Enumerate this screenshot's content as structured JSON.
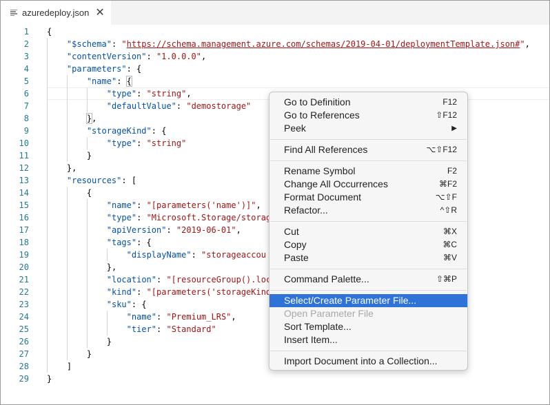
{
  "tab": {
    "title": "azuredeploy.json",
    "close_glyph": "✕",
    "file_icon": "file-lines-icon"
  },
  "editor": {
    "lines": [
      {
        "n": "1",
        "tokens": [
          {
            "t": "{",
            "c": "p"
          }
        ]
      },
      {
        "n": "2",
        "tokens": [
          {
            "t": "\"$schema\"",
            "c": "k"
          },
          {
            "t": ": ",
            "c": "p"
          },
          {
            "t": "\"",
            "c": "s"
          },
          {
            "t": "https://schema.management.azure.com/schemas/2019-04-01/deploymentTemplate.json#",
            "c": "u"
          },
          {
            "t": "\"",
            "c": "s"
          },
          {
            "t": ",",
            "c": "p"
          }
        ]
      },
      {
        "n": "3",
        "tokens": [
          {
            "t": "\"contentVersion\"",
            "c": "k"
          },
          {
            "t": ": ",
            "c": "p"
          },
          {
            "t": "\"1.0.0.0\"",
            "c": "s"
          },
          {
            "t": ",",
            "c": "p"
          }
        ]
      },
      {
        "n": "4",
        "tokens": [
          {
            "t": "\"parameters\"",
            "c": "k"
          },
          {
            "t": ": {",
            "c": "p"
          }
        ]
      },
      {
        "n": "5",
        "tokens": [
          {
            "t": "\"name\"",
            "c": "k"
          },
          {
            "t": ": ",
            "c": "p"
          },
          {
            "t": "{",
            "c": "bm"
          }
        ]
      },
      {
        "n": "6",
        "tokens": [
          {
            "t": "\"type\"",
            "c": "k"
          },
          {
            "t": ": ",
            "c": "p"
          },
          {
            "t": "\"string\"",
            "c": "s"
          },
          {
            "t": ",",
            "c": "p"
          }
        ]
      },
      {
        "n": "7",
        "tokens": [
          {
            "t": "\"defaultValue\"",
            "c": "k"
          },
          {
            "t": ": ",
            "c": "p"
          },
          {
            "t": "\"demostorage\"",
            "c": "s"
          }
        ]
      },
      {
        "n": "8",
        "tokens": [
          {
            "t": "}",
            "c": "bm"
          },
          {
            "t": ",",
            "c": "p"
          }
        ]
      },
      {
        "n": "9",
        "tokens": [
          {
            "t": "\"storageKind\"",
            "c": "k"
          },
          {
            "t": ": {",
            "c": "p"
          }
        ]
      },
      {
        "n": "10",
        "tokens": [
          {
            "t": "\"type\"",
            "c": "k"
          },
          {
            "t": ": ",
            "c": "p"
          },
          {
            "t": "\"string\"",
            "c": "s"
          }
        ]
      },
      {
        "n": "11",
        "tokens": [
          {
            "t": "}",
            "c": "p"
          }
        ]
      },
      {
        "n": "12",
        "tokens": [
          {
            "t": "},",
            "c": "p"
          }
        ]
      },
      {
        "n": "13",
        "tokens": [
          {
            "t": "\"resources\"",
            "c": "k"
          },
          {
            "t": ": [",
            "c": "p"
          }
        ]
      },
      {
        "n": "14",
        "tokens": [
          {
            "t": "{",
            "c": "p"
          }
        ]
      },
      {
        "n": "15",
        "tokens": [
          {
            "t": "\"name\"",
            "c": "k"
          },
          {
            "t": ": ",
            "c": "p"
          },
          {
            "t": "\"[parameters('name')]\"",
            "c": "s"
          },
          {
            "t": ",",
            "c": "p"
          }
        ]
      },
      {
        "n": "16",
        "tokens": [
          {
            "t": "\"type\"",
            "c": "k"
          },
          {
            "t": ": ",
            "c": "p"
          },
          {
            "t": "\"Microsoft.Storage/storag",
            "c": "s"
          }
        ]
      },
      {
        "n": "17",
        "tokens": [
          {
            "t": "\"apiVersion\"",
            "c": "k"
          },
          {
            "t": ": ",
            "c": "p"
          },
          {
            "t": "\"2019-06-01\"",
            "c": "s"
          },
          {
            "t": ",",
            "c": "p"
          }
        ]
      },
      {
        "n": "18",
        "tokens": [
          {
            "t": "\"tags\"",
            "c": "k"
          },
          {
            "t": ": {",
            "c": "p"
          }
        ]
      },
      {
        "n": "19",
        "tokens": [
          {
            "t": "\"displayName\"",
            "c": "k"
          },
          {
            "t": ": ",
            "c": "p"
          },
          {
            "t": "\"storageaccou",
            "c": "s"
          }
        ]
      },
      {
        "n": "20",
        "tokens": [
          {
            "t": "},",
            "c": "p"
          }
        ]
      },
      {
        "n": "21",
        "tokens": [
          {
            "t": "\"location\"",
            "c": "k"
          },
          {
            "t": ": ",
            "c": "p"
          },
          {
            "t": "\"[resourceGroup().loc",
            "c": "s"
          }
        ]
      },
      {
        "n": "22",
        "tokens": [
          {
            "t": "\"kind\"",
            "c": "k"
          },
          {
            "t": ": ",
            "c": "p"
          },
          {
            "t": "\"[parameters('storageKind",
            "c": "s"
          }
        ]
      },
      {
        "n": "23",
        "tokens": [
          {
            "t": "\"sku\"",
            "c": "k"
          },
          {
            "t": ": {",
            "c": "p"
          }
        ]
      },
      {
        "n": "24",
        "tokens": [
          {
            "t": "\"name\"",
            "c": "k"
          },
          {
            "t": ": ",
            "c": "p"
          },
          {
            "t": "\"Premium_LRS\"",
            "c": "s"
          },
          {
            "t": ",",
            "c": "p"
          }
        ]
      },
      {
        "n": "25",
        "tokens": [
          {
            "t": "\"tier\"",
            "c": "k"
          },
          {
            "t": ": ",
            "c": "p"
          },
          {
            "t": "\"Standard\"",
            "c": "s"
          }
        ]
      },
      {
        "n": "26",
        "tokens": [
          {
            "t": "}",
            "c": "p"
          }
        ]
      },
      {
        "n": "27",
        "tokens": [
          {
            "t": "}",
            "c": "p"
          }
        ]
      },
      {
        "n": "28",
        "tokens": [
          {
            "t": "]",
            "c": "p"
          }
        ]
      },
      {
        "n": "29",
        "tokens": [
          {
            "t": "}",
            "c": "p"
          }
        ]
      }
    ]
  },
  "context_menu": {
    "groups": [
      [
        {
          "label": "Go to Definition",
          "shortcut": "F12"
        },
        {
          "label": "Go to References",
          "shortcut": "⇧F12"
        },
        {
          "label": "Peek",
          "shortcut": "▶"
        }
      ],
      [
        {
          "label": "Find All References",
          "shortcut": "⌥⇧F12"
        }
      ],
      [
        {
          "label": "Rename Symbol",
          "shortcut": "F2"
        },
        {
          "label": "Change All Occurrences",
          "shortcut": "⌘F2"
        },
        {
          "label": "Format Document",
          "shortcut": "⌥⇧F"
        },
        {
          "label": "Refactor...",
          "shortcut": "^⇧R"
        }
      ],
      [
        {
          "label": "Cut",
          "shortcut": "⌘X"
        },
        {
          "label": "Copy",
          "shortcut": "⌘C"
        },
        {
          "label": "Paste",
          "shortcut": "⌘V"
        }
      ],
      [
        {
          "label": "Command Palette...",
          "shortcut": "⇧⌘P"
        }
      ],
      [
        {
          "label": "Select/Create Parameter File...",
          "shortcut": "",
          "state": "highlighted"
        },
        {
          "label": "Open Parameter File",
          "shortcut": "",
          "state": "disabled"
        },
        {
          "label": "Sort Template...",
          "shortcut": ""
        },
        {
          "label": "Insert Item...",
          "shortcut": ""
        }
      ],
      [
        {
          "label": "Import Document into a Collection...",
          "shortcut": ""
        }
      ]
    ]
  },
  "colors": {
    "key": "#0451a5",
    "string": "#a31515",
    "line_number": "#237893",
    "menu_highlight": "#2f73d9"
  }
}
